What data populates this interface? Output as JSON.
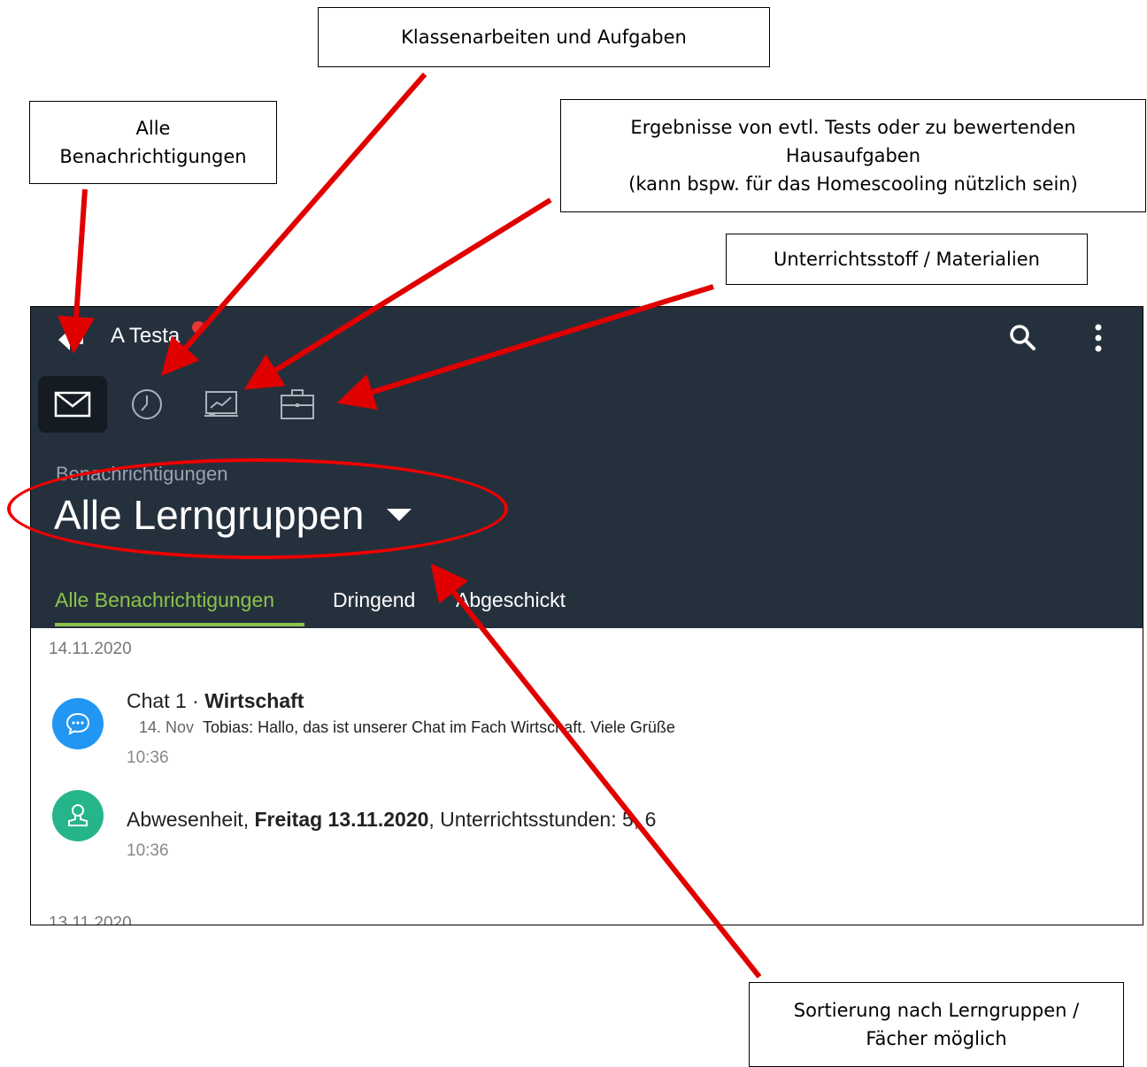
{
  "callouts": {
    "klassenarbeiten": "Klassenarbeiten und Aufgaben",
    "alle_line1": "Alle",
    "alle_line2": "Benachrichtigungen",
    "ergebnisse_line1": "Ergebnisse von evtl. Tests oder zu bewertenden",
    "ergebnisse_line2": "Hausaufgaben",
    "ergebnisse_line3": "(kann bspw. für das Homescooling nützlich sein)",
    "unterricht": "Unterrichtsstoff / Materialien",
    "sortierung_line1": "Sortierung nach Lerngruppen /",
    "sortierung_line2": "Fächer möglich"
  },
  "app": {
    "account_name": "A Testa",
    "icons": [
      "back-icon",
      "search-icon",
      "more-vertical-icon",
      "mail-icon",
      "clock-icon",
      "chart-board-icon",
      "briefcase-icon",
      "chat-icon",
      "user-icon",
      "chevron-down-icon"
    ],
    "section_label": "Benachrichtigungen",
    "group_selector": "Alle Lerngruppen",
    "tabs": [
      "Alle Benachrichtigungen",
      "Dringend",
      "Abgeschickt"
    ],
    "active_tab": 0,
    "colors": {
      "header_bg": "#25303d",
      "accent": "#8bc34a",
      "chat_blue": "#2196f3",
      "absence_green": "#26b58a",
      "annotation_red": "#e00000"
    },
    "date_groups": [
      "14.11.2020",
      "13.11.2020"
    ],
    "notifications": [
      {
        "title_prefix": "Chat 1 · ",
        "title_bold": "Wirtschaft",
        "preview_date": "14. Nov",
        "preview_text": "Tobias: Hallo, das ist unserer Chat im Fach Wirtschaft. Viele Grüße",
        "time": "10:36"
      },
      {
        "title_prefix": "Abwesenheit, ",
        "title_bold": "Freitag 13.11.2020",
        "title_suffix": ", Unterrichtsstunden: 5, 6",
        "time": "10:36"
      }
    ]
  }
}
